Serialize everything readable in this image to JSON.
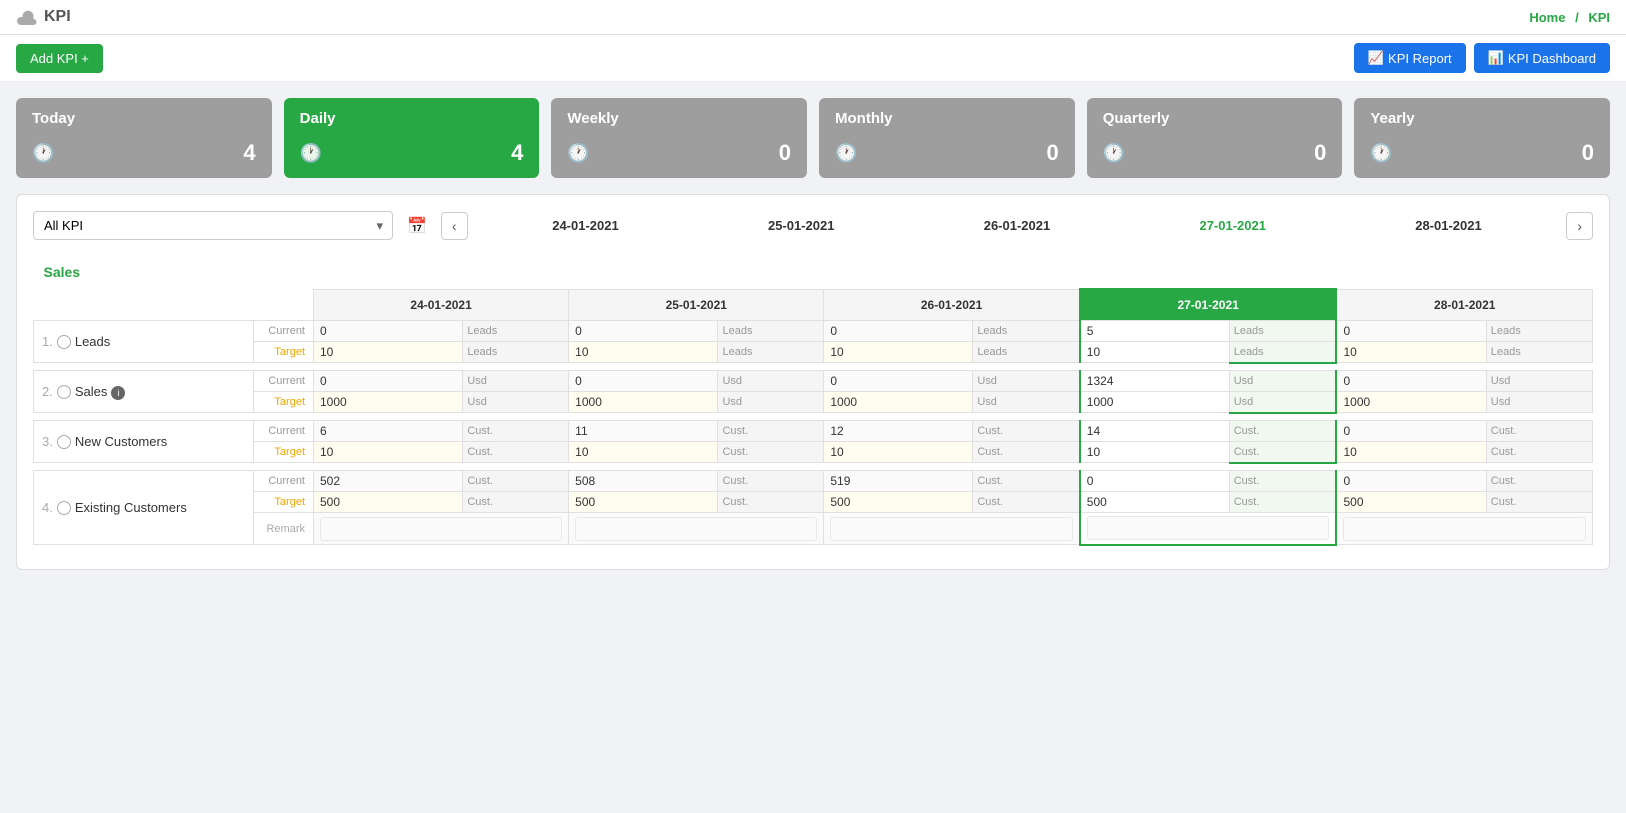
{
  "header": {
    "logo_icon": "cloud-icon",
    "title": "KPI",
    "breadcrumb_home": "Home",
    "breadcrumb_sep": "/",
    "breadcrumb_current": "KPI"
  },
  "toolbar": {
    "add_kpi_label": "Add KPI +",
    "report_label": "KPI Report",
    "dashboard_label": "KPI Dashboard"
  },
  "period_cards": [
    {
      "label": "Today",
      "count": "4",
      "active": false
    },
    {
      "label": "Daily",
      "count": "4",
      "active": true
    },
    {
      "label": "Weekly",
      "count": "0",
      "active": false
    },
    {
      "label": "Monthly",
      "count": "0",
      "active": false
    },
    {
      "label": "Quarterly",
      "count": "0",
      "active": false
    },
    {
      "label": "Yearly",
      "count": "0",
      "active": false
    }
  ],
  "filter": {
    "select_value": "All KPI",
    "select_placeholder": "All KPI"
  },
  "dates": [
    {
      "label": "24-01-2021",
      "active": false
    },
    {
      "label": "25-01-2021",
      "active": false
    },
    {
      "label": "26-01-2021",
      "active": false
    },
    {
      "label": "27-01-2021",
      "active": true
    },
    {
      "label": "28-01-2021",
      "active": false
    }
  ],
  "sections": [
    {
      "label": "Sales",
      "kpis": [
        {
          "number": "1.",
          "icon": "globe-icon",
          "name": "Leads",
          "info": false,
          "unit": "Leads",
          "rows": {
            "current": [
              "0",
              "0",
              "0",
              "5",
              "0"
            ],
            "target": [
              "10",
              "10",
              "10",
              "10",
              "10"
            ],
            "remark": false
          }
        },
        {
          "number": "2.",
          "icon": "globe-icon",
          "name": "Sales",
          "info": true,
          "unit": "Usd",
          "rows": {
            "current": [
              "0",
              "0",
              "0",
              "1324",
              "0"
            ],
            "target": [
              "1000",
              "1000",
              "1000",
              "1000",
              "1000"
            ],
            "remark": false
          }
        },
        {
          "number": "3.",
          "icon": "globe-icon",
          "name": "New Customers",
          "info": false,
          "unit": "Cust.",
          "rows": {
            "current": [
              "6",
              "11",
              "12",
              "14",
              "0"
            ],
            "target": [
              "10",
              "10",
              "10",
              "10",
              "10"
            ],
            "remark": false
          }
        },
        {
          "number": "4.",
          "icon": "globe-icon",
          "name": "Existing Customers",
          "info": false,
          "unit": "Cust.",
          "rows": {
            "current": [
              "502",
              "508",
              "519",
              "0",
              "0"
            ],
            "target": [
              "500",
              "500",
              "500",
              "500",
              "500"
            ],
            "remark": true
          }
        }
      ]
    }
  ],
  "labels": {
    "current": "Current",
    "target": "Target",
    "remark": "Remark"
  }
}
